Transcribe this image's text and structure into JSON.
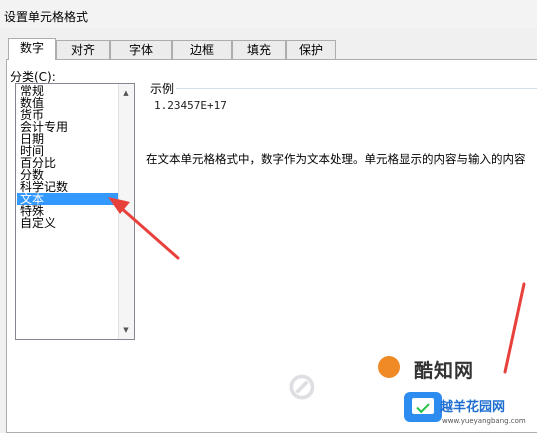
{
  "window": {
    "title": "设置单元格格式"
  },
  "tabs": [
    {
      "label": "数字",
      "active": true
    },
    {
      "label": "对齐",
      "active": false
    },
    {
      "label": "字体",
      "active": false
    },
    {
      "label": "边框",
      "active": false
    },
    {
      "label": "填充",
      "active": false
    },
    {
      "label": "保护",
      "active": false
    }
  ],
  "category": {
    "label": "分类(C):",
    "items": [
      "常规",
      "数值",
      "货币",
      "会计专用",
      "日期",
      "时间",
      "百分比",
      "分数",
      "科学记数",
      "文本",
      "特殊",
      "自定义"
    ],
    "selected_index": 9
  },
  "sample": {
    "label": "示例",
    "value": "1.23457E+17"
  },
  "description": "在文本单元格格式中，数字作为文本处理。单元格显示的内容与输入的内容",
  "watermark": {
    "brand_text": "酷知网",
    "site_text": "越羊花园网",
    "url_text": "www.yueyangbang.com"
  },
  "colors": {
    "selection": "#3399ff",
    "annotation_arrow": "#e8403a"
  }
}
